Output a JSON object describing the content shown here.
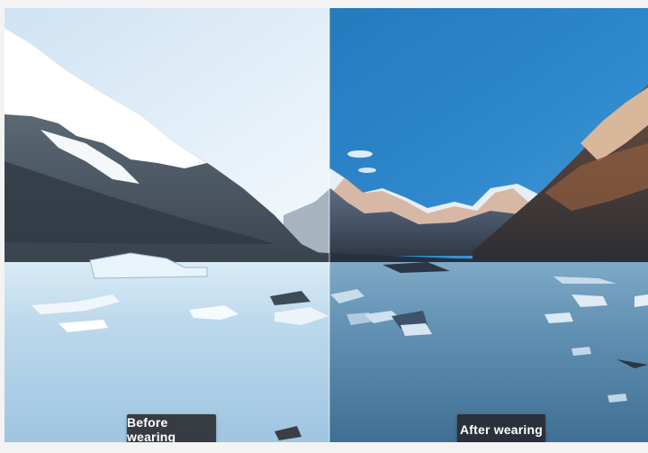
{
  "comparison": {
    "before_label": "Before wearing",
    "after_label": "After wearing"
  },
  "colors": {
    "before_sky": "#e9f3fb",
    "after_sky": "#2f86c9",
    "before_water": "#b9d7ea",
    "after_water": "#5b8db0",
    "label_bg": "#2b2b2e"
  }
}
